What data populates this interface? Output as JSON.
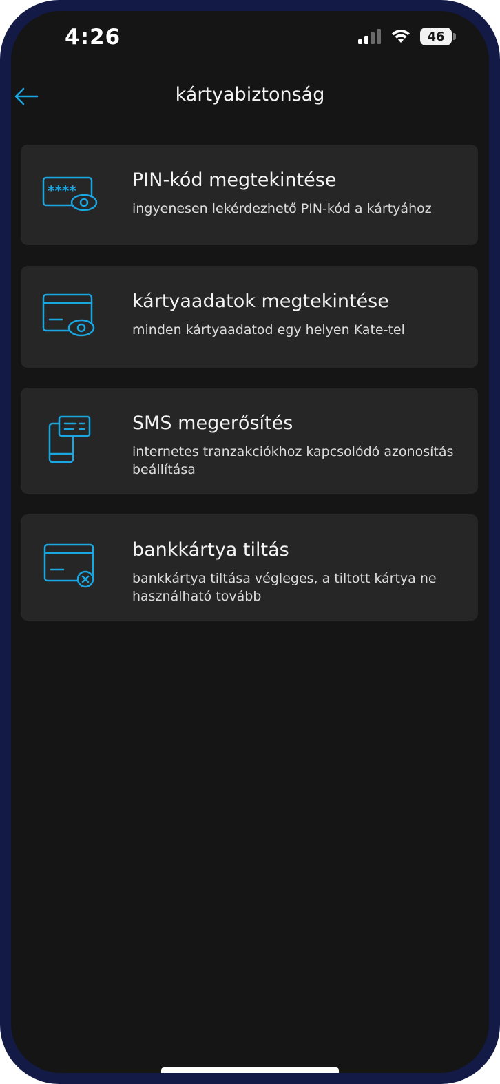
{
  "status_bar": {
    "time": "4:26",
    "battery": "46"
  },
  "header": {
    "title": "kártyabiztonság",
    "back_icon": "arrow-left-icon"
  },
  "colors": {
    "accent": "#1aa6e0",
    "background": "#151515",
    "card": "#262626",
    "frame": "#121a45"
  },
  "cards": [
    {
      "title": "PIN-kód megtekintése",
      "subtitle": "ingyenesen lekérdezhető PIN-kód a kártyához",
      "icon": "pin-view-icon"
    },
    {
      "title": "kártyaadatok megtekintése",
      "subtitle": "minden kártyaadatod egy helyen Kate-tel",
      "icon": "card-view-icon"
    },
    {
      "title": "SMS megerősítés",
      "subtitle": "internetes tranzakciókhoz kapcsolódó azonosítás beállítása",
      "icon": "sms-phone-icon"
    },
    {
      "title": "bankkártya tiltás",
      "subtitle": "bankkártya tiltása végleges, a tiltott kártya ne használható tovább",
      "icon": "card-block-icon"
    }
  ]
}
